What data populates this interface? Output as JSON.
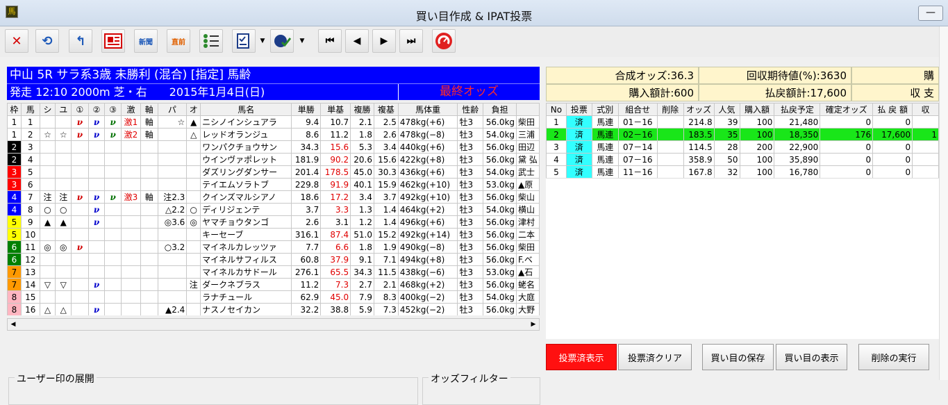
{
  "window": {
    "title": "買い目作成 & IPAT投票",
    "minimize": "—"
  },
  "race": {
    "header": "中山 5R サラ系3歳 未勝利 (混合) [指定] 馬齢",
    "start": "発走 12:10 2000m 芝・右　　2015年1月4日(日)",
    "odds_label": "最終オッズ"
  },
  "horse_columns": [
    "枠",
    "馬",
    "シ",
    "ユ",
    "①",
    "②",
    "③",
    "激",
    "軸",
    "パ",
    "オ",
    "馬名",
    "単勝",
    "単基",
    "複勝",
    "複基",
    "馬体重",
    "性齢",
    "負担",
    ""
  ],
  "horses": [
    [
      "1",
      "1",
      "",
      "",
      "ν",
      "ν",
      "ν",
      "激1",
      "軸",
      "☆",
      "▲",
      "ニシノインシュアラ",
      "9.4",
      "10.7",
      "2.1",
      "2.5",
      "478kg(+6)",
      "牡3",
      "56.0kg",
      "柴田"
    ],
    [
      "1",
      "2",
      "☆",
      "☆",
      "ν",
      "ν",
      "ν",
      "激2",
      "軸",
      "",
      "△",
      "レッドオランジュ",
      "8.6",
      "11.2",
      "1.8",
      "2.6",
      "478kg(−8)",
      "牡3",
      "54.0kg",
      "三浦"
    ],
    [
      "2",
      "3",
      "",
      "",
      "",
      "",
      "",
      "",
      "",
      "",
      "",
      "ワンパクチョウサン",
      "34.3",
      "15.6",
      "5.3",
      "3.4",
      "440kg(+6)",
      "牡3",
      "56.0kg",
      "田辺"
    ],
    [
      "2",
      "4",
      "",
      "",
      "",
      "",
      "",
      "",
      "",
      "",
      "",
      "ウインヴァポレット",
      "181.9",
      "90.2",
      "20.6",
      "15.6",
      "422kg(+8)",
      "牡3",
      "56.0kg",
      "黛 弘"
    ],
    [
      "3",
      "5",
      "",
      "",
      "",
      "",
      "",
      "",
      "",
      "",
      "",
      "ダズリングダンサー",
      "201.4",
      "178.5",
      "45.0",
      "30.3",
      "436kg(+6)",
      "牡3",
      "54.0kg",
      "武士"
    ],
    [
      "3",
      "6",
      "",
      "",
      "",
      "",
      "",
      "",
      "",
      "",
      "",
      "テイエムソラトブ",
      "229.8",
      "91.9",
      "40.1",
      "15.9",
      "462kg(+10)",
      "牡3",
      "53.0kg",
      "▲原"
    ],
    [
      "4",
      "7",
      "注",
      "注",
      "ν",
      "ν",
      "ν",
      "激3",
      "軸",
      "注2.3",
      "",
      "クインズマルシアノ",
      "18.6",
      "17.2",
      "3.4",
      "3.7",
      "492kg(+10)",
      "牡3",
      "56.0kg",
      "柴山"
    ],
    [
      "4",
      "8",
      "○",
      "○",
      "",
      "ν",
      "",
      "",
      "",
      "△2.2",
      "○",
      "ディリジェンテ",
      "3.7",
      "3.3",
      "1.3",
      "1.4",
      "464kg(+2)",
      "牡3",
      "54.0kg",
      "横山"
    ],
    [
      "5",
      "9",
      "▲",
      "▲",
      "",
      "ν",
      "",
      "",
      "",
      "◎3.6",
      "◎",
      "ヤマチョウタンゴ",
      "2.6",
      "3.1",
      "1.2",
      "1.4",
      "496kg(+6)",
      "牡3",
      "56.0kg",
      "津村"
    ],
    [
      "5",
      "10",
      "",
      "",
      "",
      "",
      "",
      "",
      "",
      "",
      "",
      "キーセーブ",
      "316.1",
      "87.4",
      "51.0",
      "15.2",
      "492kg(+14)",
      "牡3",
      "56.0kg",
      "二本"
    ],
    [
      "6",
      "11",
      "◎",
      "◎",
      "ν",
      "",
      "",
      "",
      "",
      "○3.2",
      "",
      "マイネルカレッツァ",
      "7.7",
      "6.6",
      "1.8",
      "1.9",
      "490kg(−8)",
      "牡3",
      "56.0kg",
      "柴田"
    ],
    [
      "6",
      "12",
      "",
      "",
      "",
      "",
      "",
      "",
      "",
      "",
      "",
      "マイネルサフィルス",
      "60.8",
      "37.9",
      "9.1",
      "7.1",
      "494kg(+8)",
      "牡3",
      "56.0kg",
      "F.ベ"
    ],
    [
      "7",
      "13",
      "",
      "",
      "",
      "",
      "",
      "",
      "",
      "",
      "",
      "マイネルカサドール",
      "276.1",
      "65.5",
      "34.3",
      "11.5",
      "438kg(−6)",
      "牡3",
      "53.0kg",
      "▲石"
    ],
    [
      "7",
      "14",
      "▽",
      "▽",
      "",
      "ν",
      "",
      "",
      "",
      "",
      "注",
      "ダークネブラス",
      "11.2",
      "7.3",
      "2.7",
      "2.1",
      "468kg(+2)",
      "牡3",
      "56.0kg",
      "蛯名"
    ],
    [
      "8",
      "15",
      "",
      "",
      "",
      "",
      "",
      "",
      "",
      "",
      "",
      "ラナチュール",
      "62.9",
      "45.0",
      "7.9",
      "8.3",
      "400kg(−2)",
      "牡3",
      "54.0kg",
      "大庭"
    ],
    [
      "8",
      "16",
      "△",
      "△",
      "",
      "ν",
      "",
      "",
      "",
      "▲2.4",
      "",
      "ナスノセイカン",
      "32.2",
      "38.8",
      "5.9",
      "7.3",
      "452kg(−2)",
      "牡3",
      "56.0kg",
      "大野"
    ]
  ],
  "summary": {
    "synth_odds": "合成オッズ:36.3",
    "expected_return": "回収期待値(%):3630",
    "right_top": "購",
    "purchase_total": "購入額計:600",
    "payout_total": "払戻額計:17,600",
    "right_bottom": "収 支"
  },
  "bet_columns": [
    "No",
    "投票",
    "式別",
    "組合せ",
    "削除",
    "オッズ",
    "人気",
    "購入額",
    "払戻予定",
    "確定オッズ",
    "払 戻 額",
    "収"
  ],
  "bets": [
    [
      "1",
      "済",
      "馬連",
      "01－16",
      "",
      "214.8",
      "39",
      "100",
      "21,480",
      "0",
      "0",
      ""
    ],
    [
      "2",
      "済",
      "馬連",
      "02－16",
      "",
      "183.5",
      "35",
      "100",
      "18,350",
      "176",
      "17,600",
      "1"
    ],
    [
      "3",
      "済",
      "馬連",
      "07－14",
      "",
      "114.5",
      "28",
      "200",
      "22,900",
      "0",
      "0",
      ""
    ],
    [
      "4",
      "済",
      "馬連",
      "07－16",
      "",
      "358.9",
      "50",
      "100",
      "35,890",
      "0",
      "0",
      ""
    ],
    [
      "5",
      "済",
      "馬連",
      "11－16",
      "",
      "167.8",
      "32",
      "100",
      "16,780",
      "0",
      "0",
      ""
    ]
  ],
  "bottom": {
    "user_marks": "ユーザー印の展開",
    "odds_filter": "オッズフィルター"
  },
  "buttons": {
    "vote_done_show": "投票済表示",
    "vote_done_clear": "投票済クリア",
    "save_bets": "買い目の保存",
    "show_bets": "買い目の表示",
    "exec_delete": "削除の実行"
  },
  "colors": {
    "info_blue": "#0000ff",
    "odds_red": "#ff2a2a",
    "selected_row": "#19e619",
    "voted_cell": "#33ffff"
  }
}
